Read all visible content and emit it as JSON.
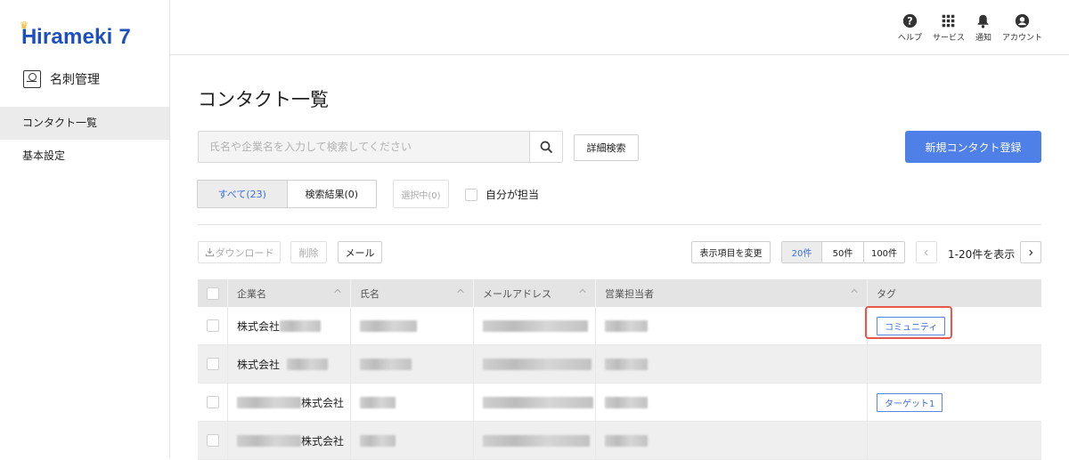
{
  "brand": {
    "logo_h": "H",
    "logo_rest": "irameki 7"
  },
  "sidebar": {
    "section": "名刺管理",
    "items": [
      {
        "label": "コンタクト一覧",
        "active": true
      },
      {
        "label": "基本設定",
        "active": false
      }
    ]
  },
  "topbar": {
    "icons": [
      {
        "label": "ヘルプ",
        "icon": "help-icon"
      },
      {
        "label": "サービス",
        "icon": "grid-icon"
      },
      {
        "label": "通知",
        "icon": "bell-icon"
      },
      {
        "label": "アカウント",
        "icon": "account-icon"
      }
    ]
  },
  "main": {
    "title": "コンタクト一覧",
    "search_placeholder": "氏名や企業名を入力して検索してください",
    "advanced_search": "詳細検索",
    "new_contact": "新規コンタクト登録",
    "filter_tabs": [
      "すべて(23)",
      "検索結果(0)"
    ],
    "selected": "選択中(0)",
    "mine_label": "自分が担当",
    "download": "ダウンロード",
    "delete": "削除",
    "mail": "メール",
    "change_columns": "表示項目を変更",
    "page_sizes": [
      "20件",
      "50件",
      "100件"
    ],
    "range_text": "1-20件を表示"
  },
  "table": {
    "headers": [
      "企業名",
      "氏名",
      "メールアドレス",
      "営業担当者",
      "タグ"
    ],
    "rows": [
      {
        "company_prefix": "株式会社",
        "company_suffix": "",
        "tag": "コミュニティ"
      },
      {
        "company_prefix": "株式会社",
        "company_suffix": "",
        "tag": ""
      },
      {
        "company_prefix": "",
        "company_suffix": "株式会社",
        "tag": "ターゲット1"
      },
      {
        "company_prefix": "",
        "company_suffix": "株式会社",
        "tag": ""
      }
    ]
  },
  "colors": {
    "accent": "#4f80e8",
    "brand": "#1f4fbf",
    "highlight": "#e8564c"
  }
}
